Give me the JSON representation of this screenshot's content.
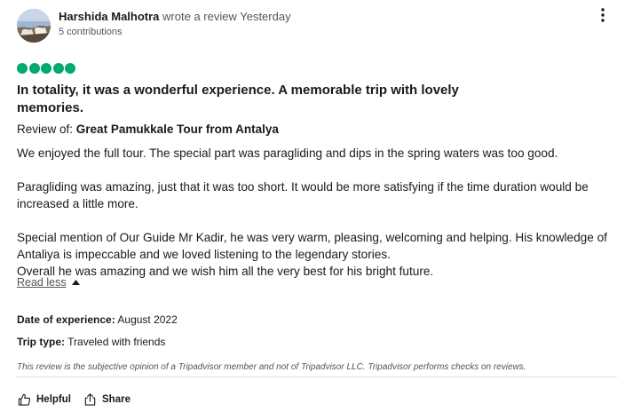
{
  "review": {
    "author_name": "Harshida Malhotra",
    "action_text": "wrote a review Yesterday",
    "contributions": "5 contributions",
    "rating": 5,
    "rating_color": "#00aa6c",
    "title": "In totality, it was a wonderful experience. A memorable trip with lovely memories.",
    "review_of_label": "Review of:",
    "review_of_name": "Great Pamukkale Tour from Antalya",
    "paragraphs": [
      "We enjoyed the full tour. The special part was paragliding and dips in the spring waters was too good.",
      "Paragliding was amazing, just that it was too short. It would be more satisfying if the time duration would be increased a little more.",
      "Special mention of Our Guide Mr Kadir, he was very warm, pleasing, welcoming and helping. His knowledge of Antaliya is impeccable and we loved listening to the legendary stories.\nOverall he was amazing and we wish him all the very best for his bright future."
    ],
    "read_less": "Read less",
    "date_label": "Date of experience:",
    "date_value": "August 2022",
    "trip_label": "Trip type:",
    "trip_value": "Traveled with friends",
    "disclaimer": "This review is the subjective opinion of a Tripadvisor member and not of Tripadvisor LLC. Tripadvisor performs checks on reviews.",
    "helpful_label": "Helpful",
    "share_label": "Share"
  },
  "icons": {
    "more": "more-options-icon",
    "read_less": "caret-up-icon",
    "helpful": "thumbs-up-icon",
    "share": "share-icon"
  }
}
